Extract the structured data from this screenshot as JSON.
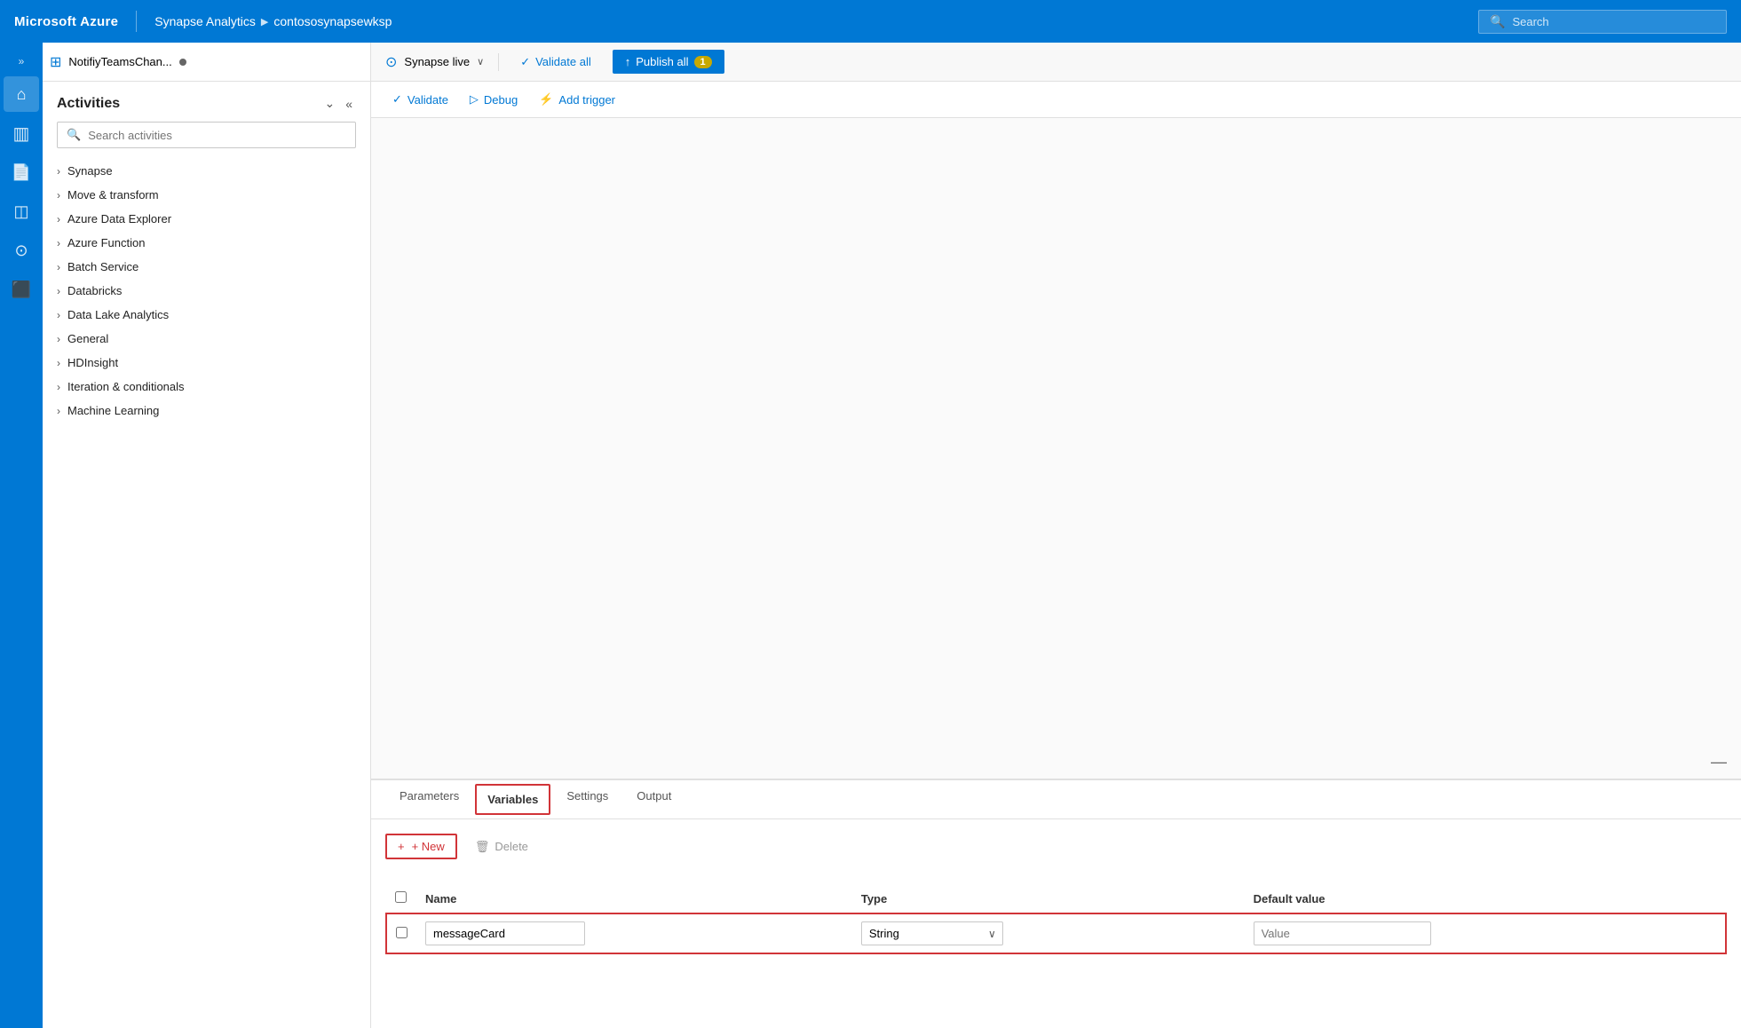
{
  "topbar": {
    "brand": "Microsoft Azure",
    "nav_app": "Synapse Analytics",
    "nav_chevron": "▶",
    "nav_workspace": "contososynapsewksp",
    "search_placeholder": "Search"
  },
  "left_nav": {
    "expand_icon": "»",
    "items": [
      {
        "name": "home",
        "icon": "⌂",
        "active": true
      },
      {
        "name": "data",
        "icon": "🗄"
      },
      {
        "name": "develop",
        "icon": "📄"
      },
      {
        "name": "integrate",
        "icon": "📦"
      },
      {
        "name": "monitor",
        "icon": "⚙"
      },
      {
        "name": "manage",
        "icon": "🧰"
      }
    ]
  },
  "toolbar": {
    "synapse_live_label": "Synapse live",
    "chevron": "∨",
    "validate_all_label": "Validate all",
    "publish_all_label": "Publish all",
    "badge_count": "1"
  },
  "tab": {
    "icon": "⊞",
    "title": "NotifiyTeamsChan...",
    "dot": true
  },
  "canvas_toolbar": {
    "validate_label": "Validate",
    "debug_label": "Debug",
    "add_trigger_label": "Add trigger"
  },
  "activities": {
    "title": "Activities",
    "collapse_icon": "⌄",
    "close_icon": "«",
    "search_placeholder": "Search activities",
    "items": [
      {
        "label": "Synapse"
      },
      {
        "label": "Move & transform"
      },
      {
        "label": "Azure Data Explorer"
      },
      {
        "label": "Azure Function"
      },
      {
        "label": "Batch Service"
      },
      {
        "label": "Databricks"
      },
      {
        "label": "Data Lake Analytics"
      },
      {
        "label": "General"
      },
      {
        "label": "HDInsight"
      },
      {
        "label": "Iteration & conditionals"
      },
      {
        "label": "Machine Learning"
      }
    ]
  },
  "panel_tabs": [
    {
      "label": "Parameters",
      "active": false
    },
    {
      "label": "Variables",
      "active": true
    },
    {
      "label": "Settings",
      "active": false
    },
    {
      "label": "Output",
      "active": false
    }
  ],
  "variables_panel": {
    "new_label": "+ New",
    "delete_label": "Delete",
    "columns": [
      "",
      "Name",
      "Type",
      "Default value"
    ],
    "rows": [
      {
        "name": "messageCard",
        "type": "String",
        "default_value": "Value",
        "highlighted": true
      }
    ]
  },
  "icons": {
    "search": "🔍",
    "validate_check": "✓",
    "debug_play": "▷",
    "trigger_bolt": "⚡",
    "publish_upload": "↑",
    "chevron_right": "›",
    "trash": "🗑",
    "plus": "+"
  }
}
